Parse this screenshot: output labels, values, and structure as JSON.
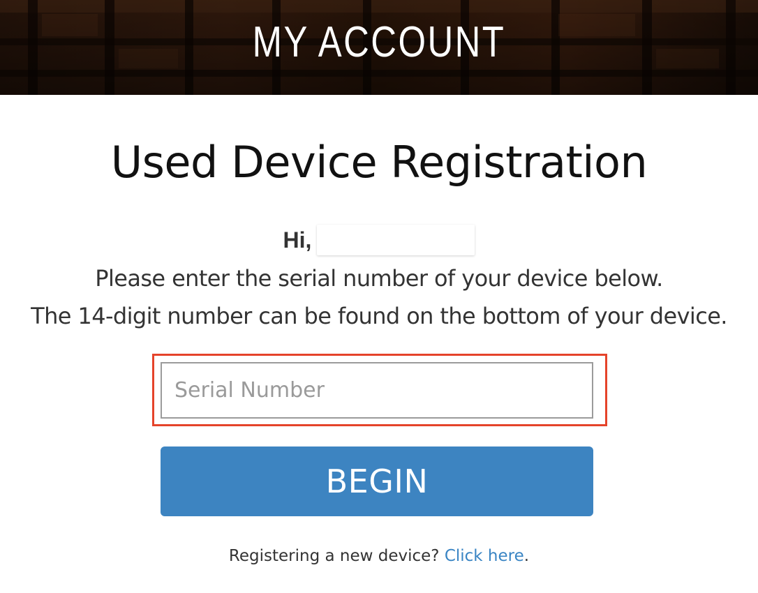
{
  "header": {
    "title": "MY ACCOUNT"
  },
  "main": {
    "title": "Used Device Registration",
    "greeting": "Hi,",
    "instruction_line_1": "Please enter the serial number of your device below.",
    "instruction_line_2": "The 14-digit number can be found on the bottom of your device.",
    "serial_input": {
      "placeholder": "Serial Number",
      "value": ""
    },
    "begin_button": "BEGIN",
    "footer": {
      "prefix": "Registering a new device?",
      "link_text": "Click here",
      "suffix": "."
    }
  },
  "colors": {
    "highlight_border": "#e5432a",
    "button_bg": "#3d84c1",
    "link": "#3a85c4",
    "banner_bg": "#1a0d06"
  }
}
